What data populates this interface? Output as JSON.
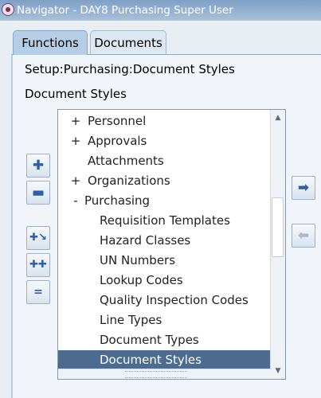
{
  "window": {
    "title": "Navigator - DAY8 Purchasing Super User"
  },
  "tabs": [
    {
      "label": "Functions"
    },
    {
      "label": "Documents"
    }
  ],
  "breadcrumb": "Setup:Purchasing:Document Styles",
  "section_title": "Document Styles",
  "tree": [
    {
      "expander": "+",
      "label": "Personnel"
    },
    {
      "expander": "+",
      "label": "Approvals"
    },
    {
      "expander": "",
      "label": "Attachments"
    },
    {
      "expander": "+",
      "label": "Organizations"
    },
    {
      "expander": "-",
      "label": "Purchasing"
    },
    {
      "expander": "",
      "label": "Requisition Templates"
    },
    {
      "expander": "",
      "label": "Hazard Classes"
    },
    {
      "expander": "",
      "label": "UN Numbers"
    },
    {
      "expander": "",
      "label": "Lookup Codes"
    },
    {
      "expander": "",
      "label": "Quality Inspection Codes"
    },
    {
      "expander": "",
      "label": "Line Types"
    },
    {
      "expander": "",
      "label": "Document Types"
    },
    {
      "expander": "",
      "label": "Document Styles",
      "selected": true
    }
  ],
  "icons": {
    "expand": "plus-icon",
    "collapse": "minus-icon",
    "expand_branch": "expand-branch-icon",
    "expand_all": "expand-all-icon",
    "collapse_all": "collapse-all-icon",
    "add_to_top_ten": "right-arrow-icon",
    "remove_from_top_ten": "left-arrow-icon"
  },
  "colors": {
    "selection": "#4d6a8f",
    "title_bar": "#7fa0c6",
    "active_tab": "#b6cde6",
    "button_glyph": "#2d5fa8"
  }
}
